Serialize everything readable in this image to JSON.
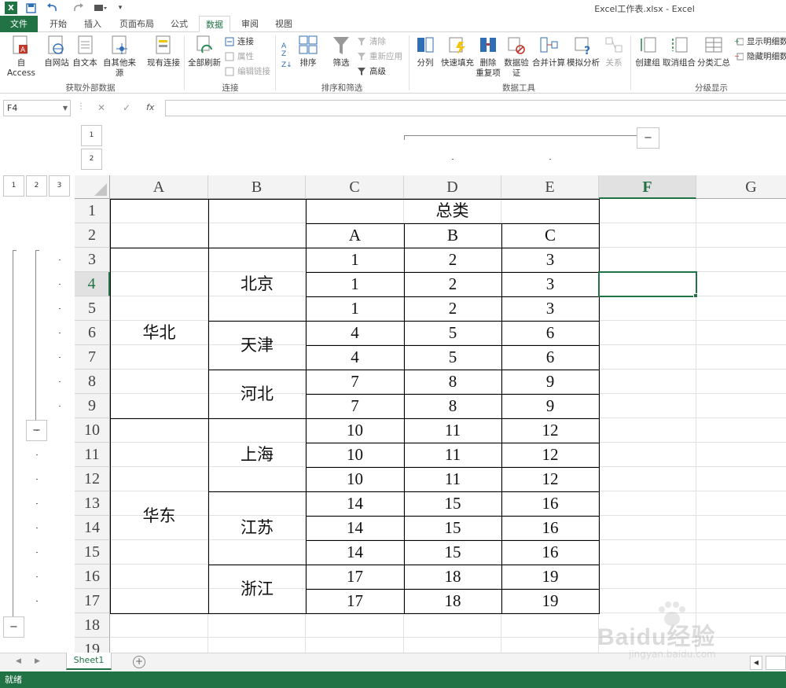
{
  "window": {
    "title": "Excel工作表.xlsx - Excel",
    "logo": "X"
  },
  "quick_access": {
    "save_icon": "save-icon",
    "undo_icon": "undo-icon",
    "redo_icon": "redo-icon",
    "customize_icon": "customize-icon"
  },
  "tabs": {
    "file": "文件",
    "home": "开始",
    "insert": "插入",
    "layout": "页面布局",
    "formulas": "公式",
    "data": "数据",
    "review": "审阅",
    "view": "视图"
  },
  "ribbon": {
    "get_external": {
      "access": "自 Access",
      "web": "自网站",
      "text": "自文本",
      "other": "自其他来源",
      "existing": "现有连接",
      "label": "获取外部数据"
    },
    "connections": {
      "refresh_all": "全部刷新",
      "connections": "连接",
      "properties": "属性",
      "edit_links": "编辑链接",
      "label": "连接"
    },
    "sort_filter": {
      "sort": "排序",
      "filter": "筛选",
      "clear": "清除",
      "reapply": "重新应用",
      "advanced": "高级",
      "label": "排序和筛选"
    },
    "data_tools": {
      "text_to_columns": "分列",
      "flash_fill": "快速填充",
      "remove_dup_1": "删除",
      "remove_dup_2": "重复项",
      "validation_1": "数据验",
      "validation_2": "证",
      "consolidate": "合并计算",
      "whatif": "模拟分析",
      "relationships": "关系",
      "label": "数据工具"
    },
    "outline": {
      "group": "创建组",
      "ungroup": "取消组合",
      "subtotal": "分类汇总",
      "show_detail": "显示明细数据",
      "hide_detail": "隐藏明细数据",
      "label": "分级显示"
    }
  },
  "formula_bar": {
    "name_box": "F4",
    "cancel": "✕",
    "enter": "✓",
    "fx": "fx",
    "value": ""
  },
  "outline": {
    "col_level_1": "1",
    "col_level_2": "2",
    "row_level_1": "1",
    "row_level_2": "2",
    "row_level_3": "3",
    "collapse": "−"
  },
  "columns": [
    "A",
    "B",
    "C",
    "D",
    "E",
    "F",
    "G"
  ],
  "rows": [
    "1",
    "2",
    "3",
    "4",
    "5",
    "6",
    "7",
    "8",
    "9",
    "10",
    "11",
    "12",
    "13",
    "14",
    "15",
    "16",
    "17",
    "18",
    "19"
  ],
  "selected_cell": "F4",
  "sheet": {
    "header_total": "总类",
    "sub_headers": [
      "A",
      "B",
      "C"
    ],
    "regions": [
      {
        "name": "华北"
      },
      {
        "name": "华东"
      }
    ],
    "cities": [
      {
        "name": "北京",
        "rows": [
          [
            "1",
            "2",
            "3"
          ],
          [
            "1",
            "2",
            "3"
          ],
          [
            "1",
            "2",
            "3"
          ]
        ]
      },
      {
        "name": "天津",
        "rows": [
          [
            "4",
            "5",
            "6"
          ],
          [
            "4",
            "5",
            "6"
          ]
        ]
      },
      {
        "name": "河北",
        "rows": [
          [
            "7",
            "8",
            "9"
          ],
          [
            "7",
            "8",
            "9"
          ]
        ]
      },
      {
        "name": "上海",
        "rows": [
          [
            "10",
            "11",
            "12"
          ],
          [
            "10",
            "11",
            "12"
          ],
          [
            "10",
            "11",
            "12"
          ]
        ]
      },
      {
        "name": "江苏",
        "rows": [
          [
            "14",
            "15",
            "16"
          ],
          [
            "14",
            "15",
            "16"
          ],
          [
            "14",
            "15",
            "16"
          ]
        ]
      },
      {
        "name": "浙江",
        "rows": [
          [
            "17",
            "18",
            "19"
          ],
          [
            "17",
            "18",
            "19"
          ]
        ]
      }
    ]
  },
  "sheet_tabs": {
    "active": "Sheet1",
    "add": "+"
  },
  "status": {
    "text": "就绪"
  },
  "watermark": {
    "text": "Baidu经验",
    "sub": "jingyan.baidu.com"
  },
  "colors": {
    "accent": "#217346",
    "ribbon_icon_blue": "#2f6db5",
    "ribbon_icon_red": "#c0392b"
  }
}
